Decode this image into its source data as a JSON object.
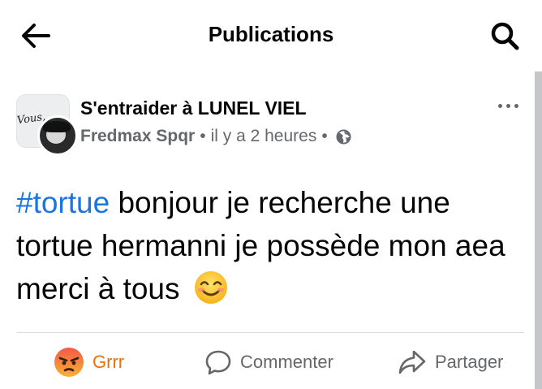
{
  "header": {
    "title": "Publications",
    "back_icon": "arrow-left-icon",
    "search_icon": "search-icon"
  },
  "post": {
    "group_name": "S'entraider à LUNEL VIEL",
    "group_avatar_text": "Vous,",
    "author": "Fredmax Spqr",
    "separator": "•",
    "time": "il y a 2 heures",
    "audience_icon": "globe-icon",
    "more_icon": "more-horizontal-icon",
    "hashtag": "#tortue",
    "text": " bonjour je recherche une tortue hermanni je possède mon aea merci à tous",
    "emoji_icon": "smiling-face-icon"
  },
  "actions": {
    "reaction_label": "Grrr",
    "reaction_icon": "angry-face-icon",
    "comment_label": "Commenter",
    "comment_icon": "comment-bubble-icon",
    "share_label": "Partager",
    "share_icon": "share-arrow-icon"
  },
  "colors": {
    "hashtag": "#1b74e4",
    "secondary_text": "#65676b",
    "angry_reaction": "#e9710f",
    "divider": "#dadde1"
  }
}
